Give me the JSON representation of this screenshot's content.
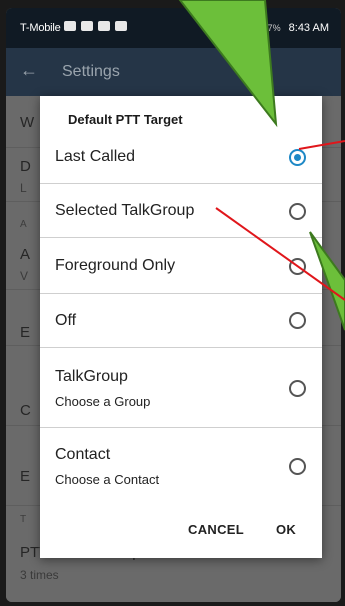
{
  "status_bar": {
    "carrier": "T-Mobile",
    "battery": "67%",
    "time": "8:43 AM",
    "icons": [
      "message-icon",
      "robot-icon",
      "robot-icon",
      "news-icon"
    ]
  },
  "app_bar": {
    "title": "Settings"
  },
  "background_rows": [
    {
      "title": "W",
      "subtitle": ""
    },
    {
      "title": "D",
      "subtitle": "L"
    },
    {
      "section": "A"
    },
    {
      "title": "A",
      "subtitle": "V"
    },
    {
      "title": "E",
      "subtitle": ""
    },
    {
      "title": "C",
      "subtitle": ""
    },
    {
      "title": "E",
      "subtitle": ""
    },
    {
      "section": "T"
    },
    {
      "title": "PTT alert tone repeat",
      "subtitle": "3 times"
    }
  ],
  "dialog": {
    "title": "Default PTT Target",
    "options": [
      {
        "label": "Last Called",
        "sub": "",
        "selected": true
      },
      {
        "label": "Selected TalkGroup",
        "sub": "",
        "selected": false
      },
      {
        "label": "Foreground Only",
        "sub": "",
        "selected": false
      },
      {
        "label": "Off",
        "sub": "",
        "selected": false
      },
      {
        "label": "TalkGroup",
        "sub": "Choose a Group",
        "selected": false
      },
      {
        "label": "Contact",
        "sub": "Choose a Contact",
        "selected": false
      }
    ],
    "cancel_label": "CANCEL",
    "ok_label": "OK"
  },
  "colors": {
    "accent": "#1e88c6",
    "annotation_arrow": "#6cbf3a",
    "annotation_line": "#e0161b"
  }
}
